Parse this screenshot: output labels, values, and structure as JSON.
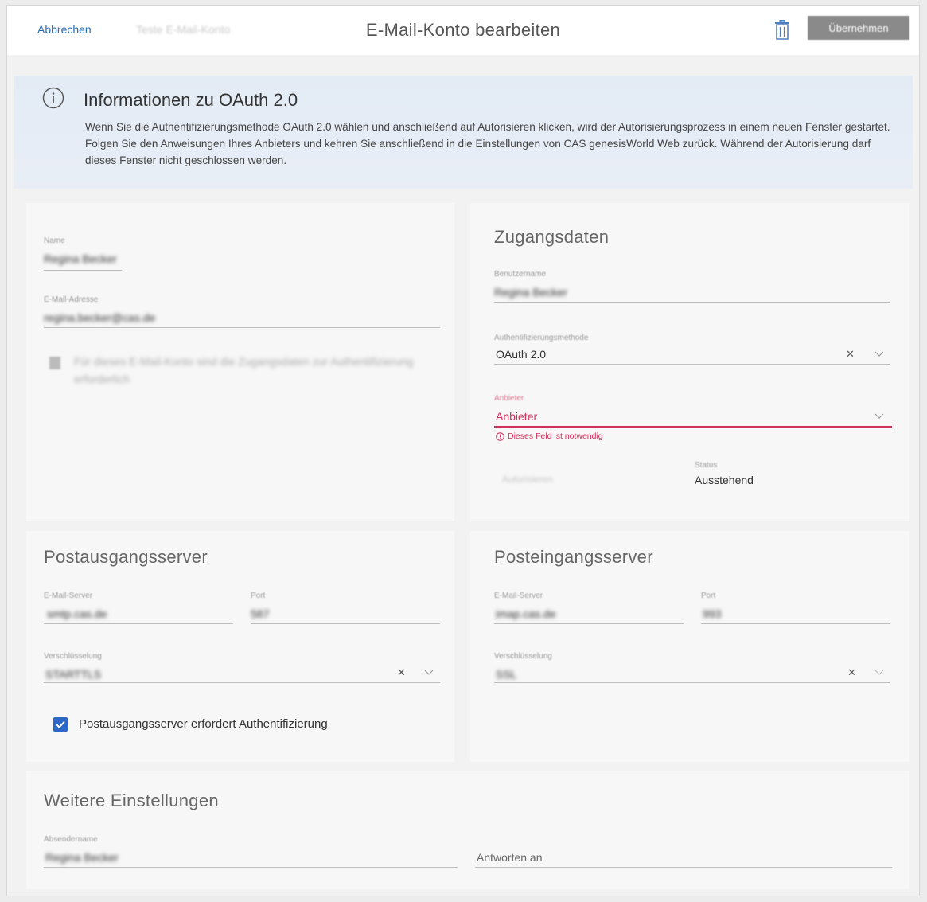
{
  "header": {
    "cancel_label": "Abbrechen",
    "secondary_label": "Teste E-Mail-Konto",
    "title": "E-Mail-Konto bearbeiten",
    "save_label": "Übernehmen"
  },
  "info": {
    "title": "Informationen zu OAuth 2.0",
    "text": "Wenn Sie die Authentifizierungsmethode OAuth 2.0 wählen und anschließend auf Autorisieren klicken, wird der Autorisierungsprozess in einem neuen Fenster gestartet. Folgen Sie den Anweisungen Ihres Anbieters und kehren Sie anschließend in die Einstellungen von CAS genesisWorld Web zurück. Während der Autorisierung darf dieses Fenster nicht geschlossen werden."
  },
  "account": {
    "name_label": "Name",
    "name_value": "Regina Becker",
    "email_label": "E-Mail-Adresse",
    "email_value": "regina.becker@cas.de",
    "note_text": "Für dieses E-Mail-Konto sind die Zugangsdaten zur Authentifizierung erforderlich",
    "icon": "document-icon"
  },
  "credentials": {
    "title": "Zugangsdaten",
    "username_label": "Benutzername",
    "username_value": "Regina Becker",
    "auth_label": "Authentifizierungsmethode",
    "auth_value": "OAuth 2.0",
    "provider_label": "Anbieter",
    "provider_placeholder": "Anbieter",
    "provider_error": "Dieses Feld ist notwendig",
    "authorize_label": "Autorisieren",
    "status_label": "Status",
    "status_value": "Ausstehend"
  },
  "outgoing": {
    "title": "Postausgangsserver",
    "server_label": "E-Mail-Server",
    "server_value": "smtp.cas.de",
    "port_label": "Port",
    "port_value": "587",
    "encryption_label": "Verschlüsselung",
    "encryption_value": "STARTTLS",
    "auth_required_label": "Postausgangsserver erfordert Authentifizierung",
    "auth_required_checked": true
  },
  "incoming": {
    "title": "Posteingangsserver",
    "server_label": "E-Mail-Server",
    "server_value": "imap.cas.de",
    "port_label": "Port",
    "port_value": "993",
    "encryption_label": "Verschlüsselung",
    "encryption_value": "SSL"
  },
  "more": {
    "title": "Weitere Einstellungen",
    "sender_label": "Absendername",
    "sender_value": "Regina Becker",
    "reply_placeholder": "Antworten an"
  },
  "colors": {
    "accent": "#2b6cb0",
    "error": "#d0305a",
    "checkbox": "#2c67c7",
    "banner": "#e5ecf5"
  }
}
